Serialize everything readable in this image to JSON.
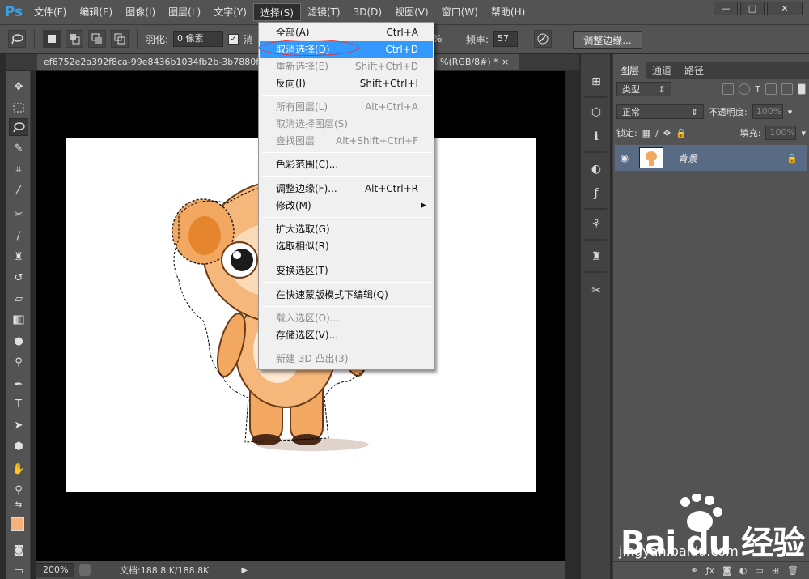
{
  "app": {
    "logo": "Ps"
  },
  "menubar": {
    "items": [
      "文件(F)",
      "编辑(E)",
      "图像(I)",
      "图层(L)",
      "文字(Y)",
      "选择(S)",
      "滤镜(T)",
      "3D(D)",
      "视图(V)",
      "窗口(W)",
      "帮助(H)"
    ],
    "active_index": 5
  },
  "window_controls": {
    "minimize": "—",
    "maximize": "□",
    "close": "✕"
  },
  "options": {
    "feather_label": "羽化:",
    "feather_value": "0 像素",
    "antialias_partial": "消",
    "width_percent": "%",
    "frequency_label": "频率:",
    "frequency_value": "57",
    "refine_edge_button": "调整边缘..."
  },
  "document_tab": {
    "title": "ef6752e2a392f8ca-99e8436b1034fb2b-3b7880f",
    "suffix": "%(RGB/8#) *",
    "close": "×"
  },
  "status": {
    "zoom": "200%",
    "doc_info": "文档:188.8 K/188.8K"
  },
  "layers_panel": {
    "tabs": [
      "图层",
      "通道",
      "路径"
    ],
    "active_tab": 0,
    "filter_kind": "类型",
    "blend_mode": "正常",
    "opacity_label": "不透明度:",
    "opacity_value": "100%",
    "lock_label": "锁定:",
    "fill_label": "填充:",
    "fill_value": "100%",
    "layer_name": "背景"
  },
  "select_menu": {
    "items": [
      {
        "label": "全部(A)",
        "shortcut": "Ctrl+A",
        "disabled": false
      },
      {
        "label": "取消选择(D)",
        "shortcut": "Ctrl+D",
        "disabled": false,
        "highlighted": true
      },
      {
        "label": "重新选择(E)",
        "shortcut": "Shift+Ctrl+D",
        "disabled": true
      },
      {
        "label": "反向(I)",
        "shortcut": "Shift+Ctrl+I",
        "disabled": false
      },
      {
        "label": "所有图层(L)",
        "shortcut": "Alt+Ctrl+A",
        "disabled": true
      },
      {
        "label": "取消选择图层(S)",
        "shortcut": "",
        "disabled": true
      },
      {
        "label": "查找图层",
        "shortcut": "Alt+Shift+Ctrl+F",
        "disabled": true
      },
      {
        "label": "色彩范围(C)...",
        "shortcut": "",
        "disabled": false
      },
      {
        "label": "调整边缘(F)...",
        "shortcut": "Alt+Ctrl+R",
        "disabled": false
      },
      {
        "label": "修改(M)",
        "shortcut": "",
        "disabled": false,
        "submenu": true
      },
      {
        "label": "扩大选取(G)",
        "shortcut": "",
        "disabled": false
      },
      {
        "label": "选取相似(R)",
        "shortcut": "",
        "disabled": false
      },
      {
        "label": "变换选区(T)",
        "shortcut": "",
        "disabled": false
      },
      {
        "label": "在快速蒙版模式下编辑(Q)",
        "shortcut": "",
        "disabled": false
      },
      {
        "label": "载入选区(O)...",
        "shortcut": "",
        "disabled": true
      },
      {
        "label": "存储选区(V)...",
        "shortcut": "",
        "disabled": false
      },
      {
        "label": "新建 3D 凸出(3)",
        "shortcut": "",
        "disabled": true
      }
    ]
  },
  "colors": {
    "foreground": "#f7b27a",
    "background": "#ffffff",
    "menu_highlight": "#3399ff"
  },
  "watermark": {
    "text": "Bai du 经验",
    "url": "jingyan.baidu.com"
  }
}
